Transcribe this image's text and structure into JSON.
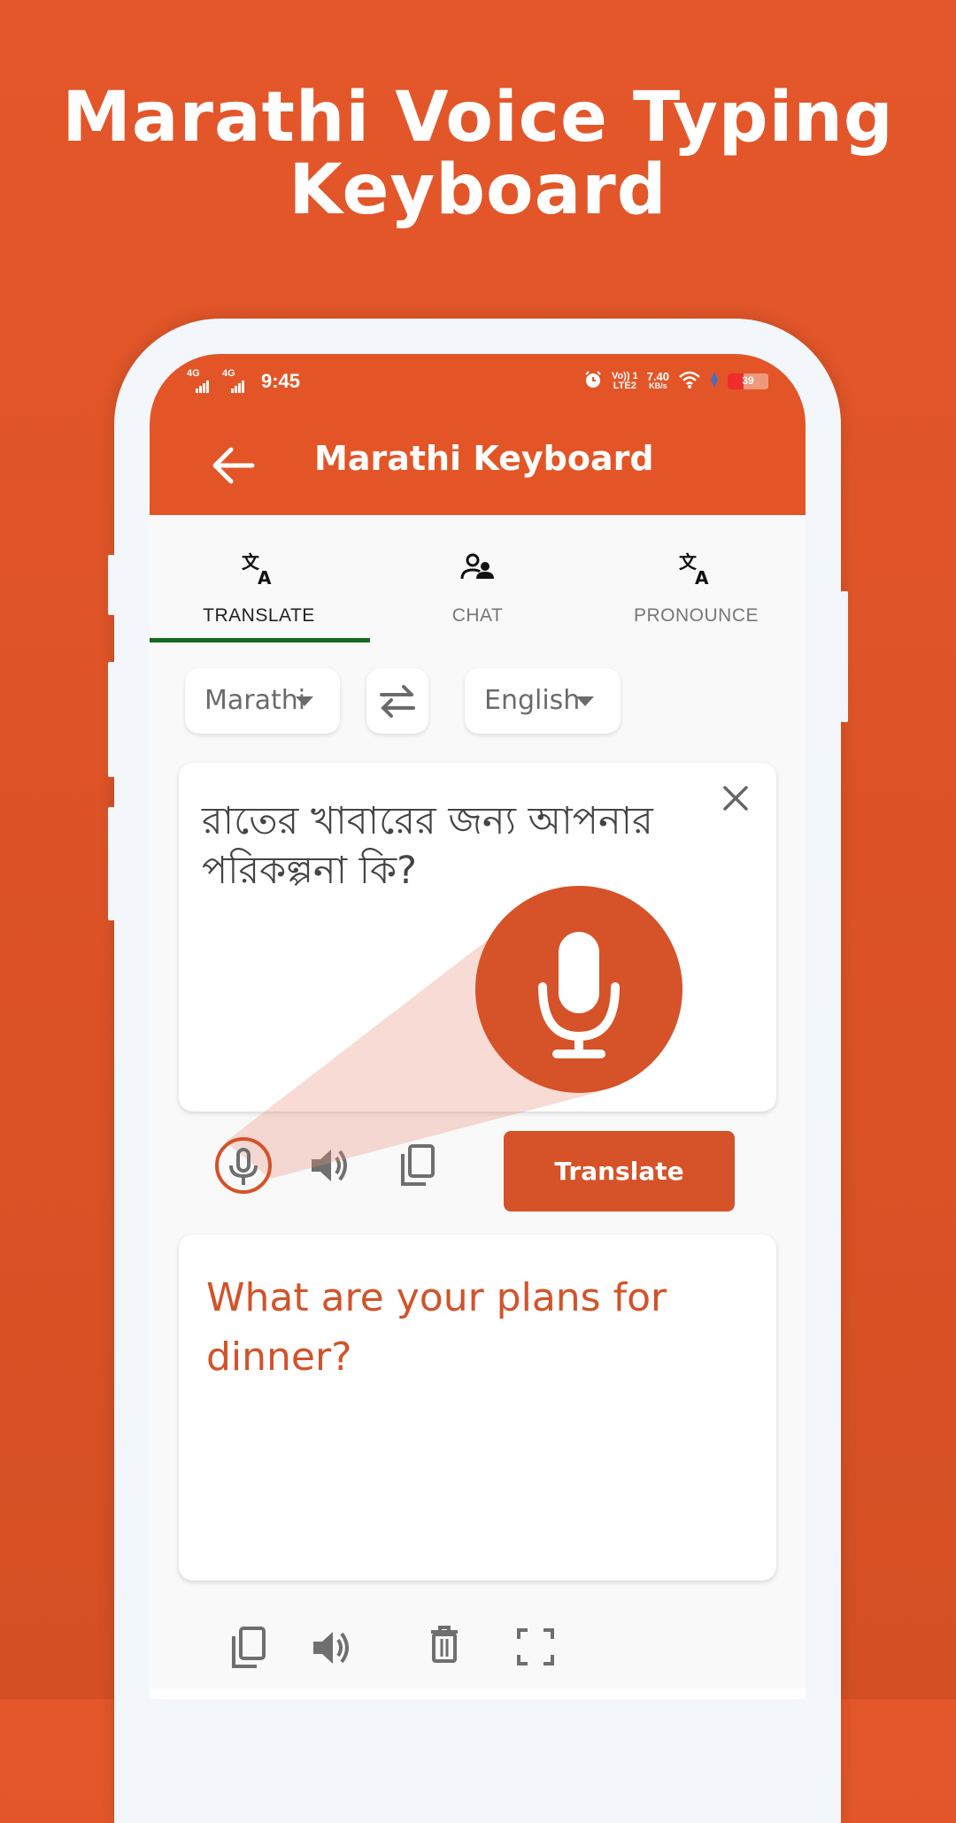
{
  "promo": {
    "title_line1": "Marathi Voice Typing",
    "title_line2": "Keyboard"
  },
  "status_bar": {
    "sim1": "4G",
    "sim2": "4G",
    "time": "9:45",
    "alarm_icon": "alarm-icon",
    "volte_line1": "Vo)) 1",
    "volte_line2": "LTE2",
    "speed_value": "7.40",
    "speed_unit": "KB/s",
    "battery_percent": "39",
    "battery_level": 0.39
  },
  "app_bar": {
    "title": "Marathi Keyboard",
    "back_icon": "arrow-back-icon"
  },
  "tabs": [
    {
      "label": "TRANSLATE",
      "icon": "translate-icon",
      "active": true
    },
    {
      "label": "CHAT",
      "icon": "people-icon",
      "active": false
    },
    {
      "label": "PRONOUNCE",
      "icon": "translate-icon",
      "active": false
    }
  ],
  "languages": {
    "source": "Marathi",
    "target": "English",
    "swap_icon": "swap-arrows-icon"
  },
  "input": {
    "text": "রাতের খাবারের জন্য আপনার পরিকল্পনা কি?",
    "clear_icon": "close-icon"
  },
  "actions": {
    "translate_label": "Translate"
  },
  "output": {
    "text": "What are your plans for dinner?"
  },
  "colors": {
    "brand": "#E35527",
    "button": "#D65228",
    "tab_indicator": "#166A1E",
    "output_text": "#D2532A"
  }
}
